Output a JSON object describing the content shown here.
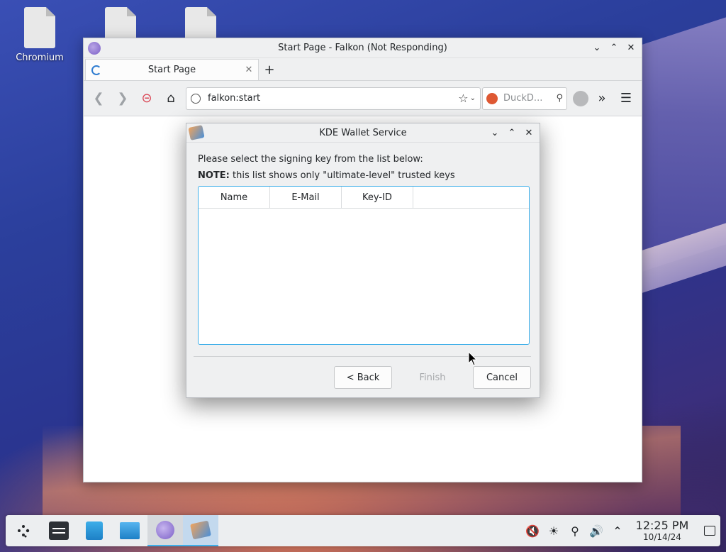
{
  "desktop": {
    "icons": [
      {
        "label": "Chromium"
      },
      {
        "label": ""
      },
      {
        "label": ""
      }
    ]
  },
  "browser": {
    "window_title": "Start Page - Falkon (Not Responding)",
    "tab": {
      "title": "Start Page"
    },
    "url": "falkon:start",
    "search_placeholder": "DuckD..."
  },
  "dialog": {
    "title": "KDE Wallet Service",
    "prompt": "Please select the signing key from the list below:",
    "note_bold": "NOTE:",
    "note_text": " this list shows only \"ultimate-level\" trusted keys",
    "columns": [
      "Name",
      "E-Mail",
      "Key-ID"
    ],
    "buttons": {
      "back": "< Back",
      "finish": "Finish",
      "cancel": "Cancel"
    }
  },
  "taskbar": {
    "time": "12:25 PM",
    "date": "10/14/24"
  },
  "colors": {
    "accent": "#3daee9",
    "stop_red": "#da4453",
    "duckduckgo": "#de5833"
  }
}
